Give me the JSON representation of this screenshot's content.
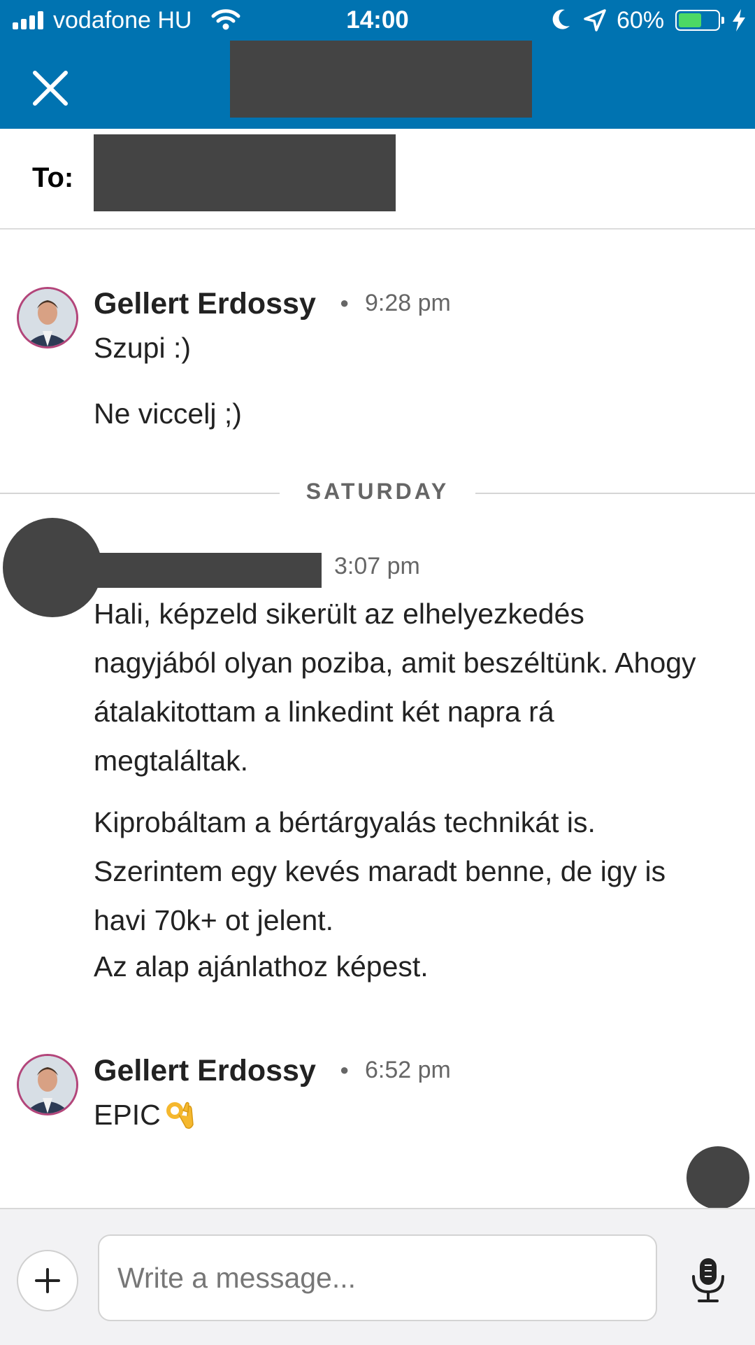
{
  "status_bar": {
    "carrier": "vodafone HU",
    "time": "14:00",
    "battery_pct": "60%",
    "battery_level": 0.6,
    "icons": [
      "signal-icon",
      "wifi-icon",
      "moon-icon",
      "location-arrow-icon",
      "battery-icon",
      "charging-bolt-icon"
    ]
  },
  "header": {
    "close_icon": "close-icon",
    "title_redacted": true
  },
  "recipients": {
    "label": "To:",
    "name_redacted": true
  },
  "colors": {
    "header_bg": "#0073b1",
    "redaction": "#444444",
    "avatar_ring": "#b3457a",
    "battery_fill": "#4cd964"
  },
  "thread": {
    "groups": [
      {
        "sender": "Gellert Erdossy",
        "time": "9:28 pm",
        "messages": [
          "Szupi :)",
          "Ne viccelj ;)"
        ]
      }
    ],
    "day_divider": "SATURDAY",
    "redacted_group": {
      "time": "3:07 pm",
      "messages": [
        "Hali, képzeld sikerült az elhelyezkedés nagyjából olyan poziba, amit beszéltünk. Ahogy átalakitottam a linkedint két napra rá megtaláltak.",
        "Kiprobáltam a bértárgyalás technikát is. Szerintem egy kevés maradt benne, de igy is havi 70k+ ot jelent.",
        "Az alap ajánlathoz képest."
      ]
    },
    "last_group": {
      "sender": "Gellert Erdossy",
      "time": "6:52 pm",
      "message": "EPIC",
      "emoji_icon": "ok-hand-emoji-icon"
    }
  },
  "compose": {
    "placeholder": "Write a message...",
    "add_icon": "plus-icon",
    "voice_icon": "microphone-icon"
  }
}
